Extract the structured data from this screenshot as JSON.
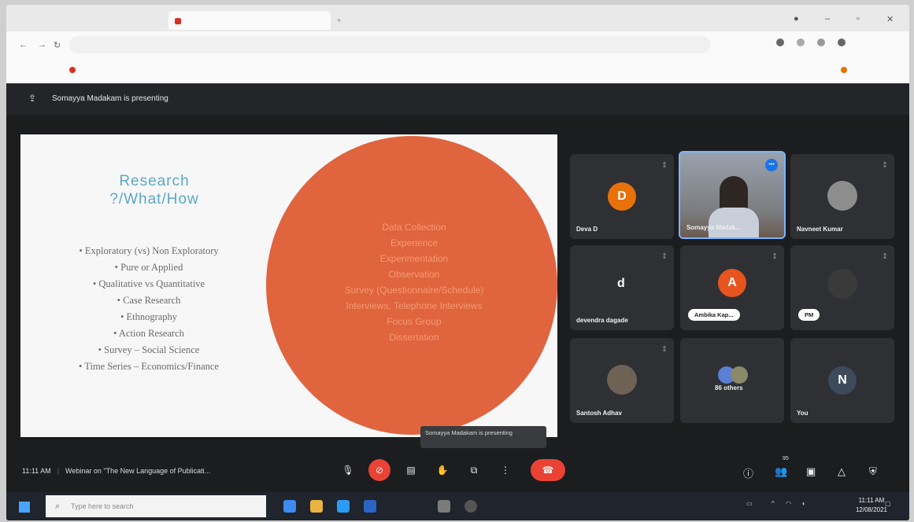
{
  "presenting": "Somayya Madakam is presenting",
  "slide": {
    "title_line1": "Research",
    "title_line2": "?/What/How",
    "items": [
      "Exploratory (vs) Non Exploratory",
      "Pure or Applied",
      "Qualitative vs Quantitative",
      "Case Research",
      "Ethnography",
      "Action Research",
      "Survey – Social Science",
      "Time Series – Economics/Finance"
    ],
    "circle_items": [
      "Data Collection",
      "Experience",
      "Experimentation",
      "Observation",
      "Survey (Questionnaire/Schedule)",
      "Interviews, Telephone Interviews",
      "Focus Group",
      "Dissertation"
    ]
  },
  "tooltip": "Somayya Madakam is presenting",
  "participants": [
    {
      "name": "Deva D",
      "initial": "D",
      "color": "#e8710a"
    },
    {
      "name": "Somayya Madak...",
      "speaking": true
    },
    {
      "name": "Navneet Kumar"
    },
    {
      "name": "devendra dagade",
      "initial": "d"
    },
    {
      "name": "Ambika Kap...",
      "initial": "A",
      "color": "#e8541f"
    },
    {
      "name": "PM"
    },
    {
      "name": "Santosh Adhav"
    },
    {
      "name": "86 others"
    },
    {
      "name": "You",
      "initial": "N",
      "color": "#3c4a5c"
    }
  ],
  "meeting": {
    "time": "11:11 AM",
    "title": "Webinar on \"The New Language of Publicati...",
    "participant_count": "95"
  },
  "taskbar": {
    "search_placeholder": "Type here to search",
    "time": "11:11 AM",
    "date": "12/08/2021"
  },
  "colors": {
    "slide_circle": "#e0643e",
    "title_blue": "#5aa8c8",
    "end_call": "#ea4335"
  }
}
